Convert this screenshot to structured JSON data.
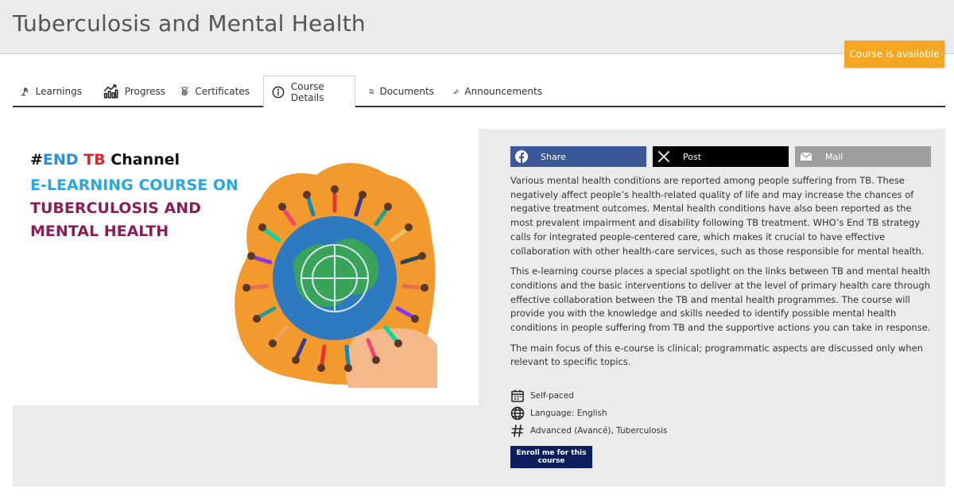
{
  "header": {
    "title": "Tuberculosis and Mental Health"
  },
  "status": {
    "label": "Course is available",
    "color": "#f5a623"
  },
  "tabs": [
    {
      "label": "Learnings",
      "icon": "lamp-icon"
    },
    {
      "label": "Progress",
      "icon": "chart-icon"
    },
    {
      "label": "Certificates",
      "icon": "medal-icon"
    },
    {
      "label": "Course Details",
      "icon": "info-icon",
      "active": true
    },
    {
      "label": "Documents",
      "icon": "document-icon"
    },
    {
      "label": "Announcements",
      "icon": "broadcast-icon"
    }
  ],
  "banner": {
    "hashtag": "#",
    "end": "END",
    "tb": "TB",
    "channel": "Channel",
    "line2": "E-LEARNING COURSE ON",
    "line3": "TUBERCULOSIS AND",
    "line4": "MENTAL HEALTH"
  },
  "share": {
    "facebook": "Share",
    "x": "Post",
    "mail": "Mail"
  },
  "description": [
    "Various mental health conditions are reported among people suffering from TB. These negatively affect people’s health-related quality of life and may increase the chances of negative treatment outcomes. Mental health conditions have also been reported as the most prevalent impairment and disability following TB treatment. WHO’s End TB strategy calls for integrated people-centered care, which makes it crucial to have effective collaboration with other health-care services, such as those responsible for mental health.",
    "This e-learning course places a special spotlight on the links between TB and mental health conditions and the basic interventions to deliver at the level of primary health care through effective collaboration between the TB and mental health programmes. The course will provide you with the knowledge and skills needed to identify possible mental health conditions in people suffering from TB and the supportive actions you can take in response.",
    "The main focus of this e-course is clinical; programmatic aspects are discussed only when relevant to specific topics."
  ],
  "meta": {
    "pace": "Self-paced",
    "language": "Language: English",
    "tags": "Advanced (Avancé), Tuberculosis"
  },
  "enroll": {
    "label": "Enroll me for this course"
  }
}
